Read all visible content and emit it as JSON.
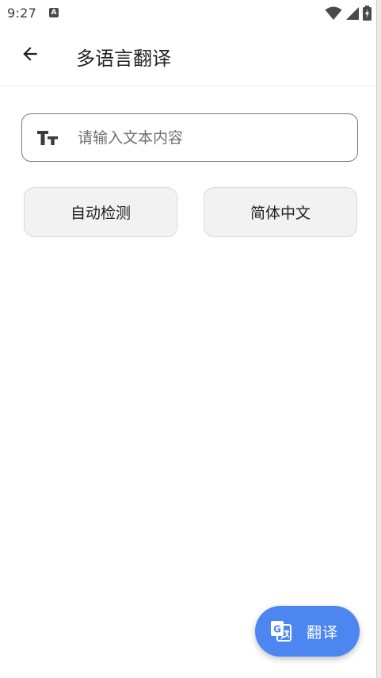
{
  "status_bar": {
    "time": "9:27",
    "notification_icon": "A",
    "icons": [
      "wifi-icon",
      "signal-icon",
      "battery-charging-icon"
    ]
  },
  "app_bar": {
    "back_icon": "arrow-left-icon",
    "title": "多语言翻译"
  },
  "input": {
    "icon": "text-size-icon",
    "value": "",
    "placeholder": "请输入文本内容"
  },
  "languages": {
    "source": "自动检测",
    "target": "简体中文"
  },
  "fab": {
    "icon": "translate-icon",
    "label": "翻译"
  },
  "colors": {
    "accent": "#4c86f0",
    "button_bg": "#f2f2f2",
    "text": "#1f1f1f"
  }
}
